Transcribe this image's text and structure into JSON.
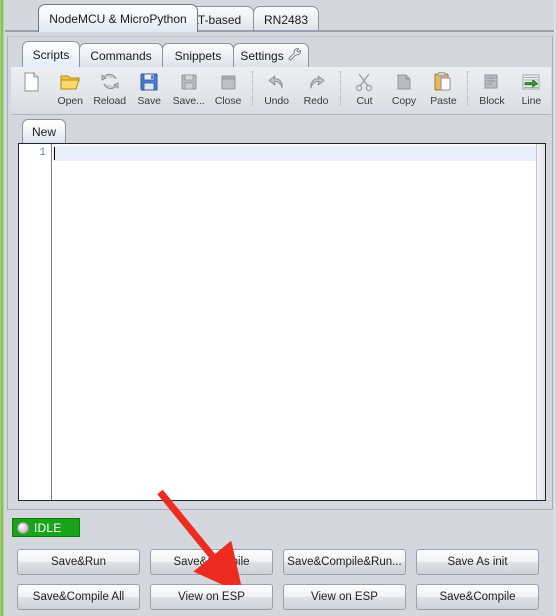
{
  "window": {
    "accent_green": "#7fc142",
    "background": "#d4d7de"
  },
  "top_tabs": [
    {
      "label": "NodeMCU & MicroPython",
      "selected": true
    },
    {
      "label": "AT-based",
      "selected": false
    },
    {
      "label": "RN2483",
      "selected": false
    }
  ],
  "sub_tabs": [
    {
      "label": "Scripts",
      "selected": true
    },
    {
      "label": "Commands",
      "selected": false
    },
    {
      "label": "Snippets",
      "selected": false
    },
    {
      "label": "Settings",
      "selected": false,
      "icon": "wrench-icon"
    }
  ],
  "toolbar": {
    "items": [
      {
        "label": "",
        "icon": "new-file-icon"
      },
      {
        "label": "Open",
        "icon": "open-folder-icon"
      },
      {
        "label": "Reload",
        "icon": "reload-icon"
      },
      {
        "label": "Save",
        "icon": "save-floppy-icon"
      },
      {
        "label": "Save...",
        "icon": "save-as-icon"
      },
      {
        "label": "Close",
        "icon": "close-door-icon"
      },
      {
        "label": "Undo",
        "icon": "undo-arrow-icon"
      },
      {
        "label": "Redo",
        "icon": "redo-arrow-icon"
      },
      {
        "label": "Cut",
        "icon": "scissors-icon"
      },
      {
        "label": "Copy",
        "icon": "copy-icon"
      },
      {
        "label": "Paste",
        "icon": "clipboard-paste-icon"
      },
      {
        "label": "Block",
        "icon": "block-icon"
      },
      {
        "label": "Line",
        "icon": "line-insert-icon"
      }
    ]
  },
  "editor": {
    "tab_label": "New",
    "line_numbers": [
      "1"
    ],
    "content": ""
  },
  "status": {
    "label": "IDLE",
    "color": "#19a319",
    "icon": "status-circle-icon"
  },
  "bottom_buttons": {
    "row1": [
      "Save&Run",
      "Save&Compile",
      "Save&Compile&Run...",
      "Save As init"
    ],
    "row2": [
      "Save&Compile All",
      "View on ESP",
      "View on ESP",
      "Save&Compile"
    ]
  },
  "annotation": {
    "arrow_color": "#ee2b20",
    "points_to": "Save&Compile"
  }
}
